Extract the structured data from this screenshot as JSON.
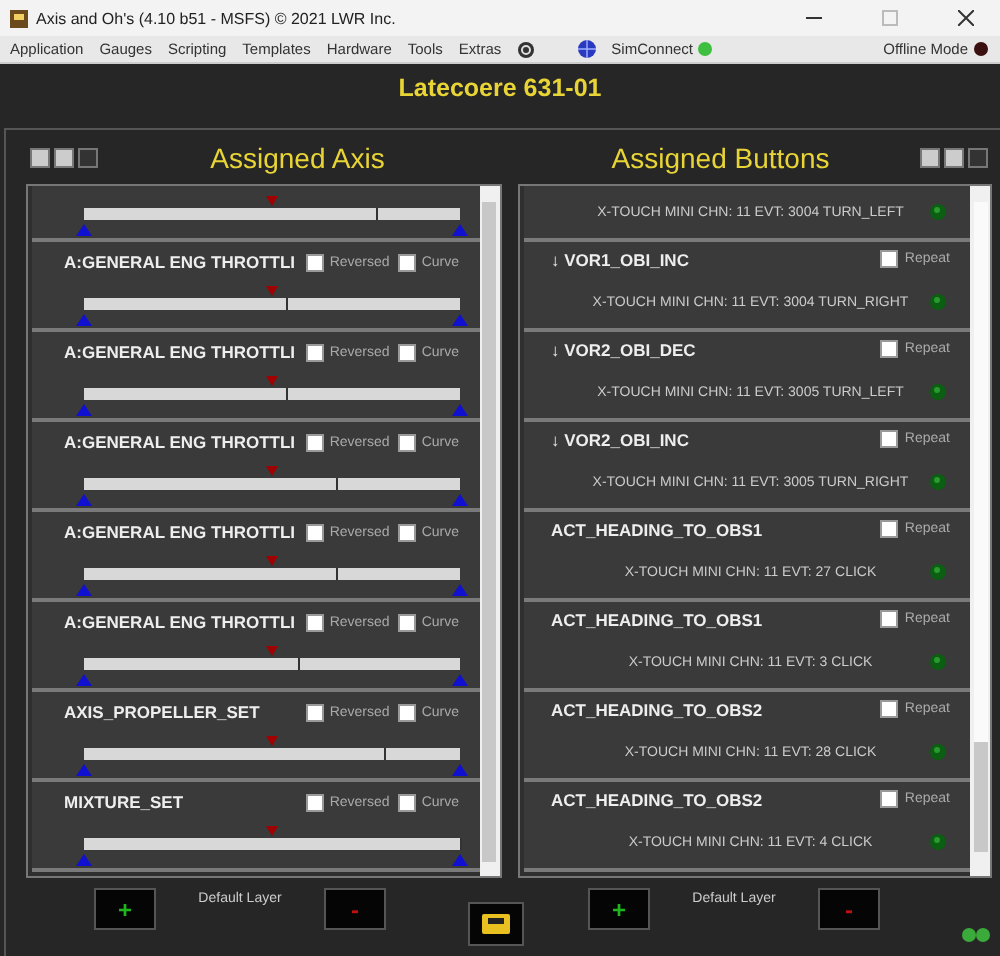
{
  "window": {
    "title": "Axis and Oh's (4.10 b51 - MSFS) © 2021 LWR Inc."
  },
  "menu": [
    "Application",
    "Gauges",
    "Scripting",
    "Templates",
    "Hardware",
    "Tools",
    "Extras"
  ],
  "simconnect": {
    "label": "SimConnect",
    "connected": true
  },
  "offline_mode": {
    "label": "Offline Mode",
    "on": false
  },
  "profile_title": "Latecoere 631-01",
  "axis_panel": {
    "heading": "Assigned Axis",
    "rows": [
      {
        "kind": "partial",
        "level": 0.78
      },
      {
        "kind": "axis",
        "name": "A:GENERAL ENG THROTTLI",
        "reversed": false,
        "reversed_label": "Reversed",
        "curve": false,
        "curve_label": "Curve",
        "level": 0.54
      },
      {
        "kind": "axis",
        "name": "A:GENERAL ENG THROTTLI",
        "reversed": false,
        "reversed_label": "Reversed",
        "curve": false,
        "curve_label": "Curve",
        "level": 0.54
      },
      {
        "kind": "axis",
        "name": "A:GENERAL ENG THROTTLI",
        "reversed": false,
        "reversed_label": "Reversed",
        "curve": false,
        "curve_label": "Curve",
        "level": 0.67
      },
      {
        "kind": "axis",
        "name": "A:GENERAL ENG THROTTLI",
        "reversed": false,
        "reversed_label": "Reversed",
        "curve": false,
        "curve_label": "Curve",
        "level": 0.67
      },
      {
        "kind": "axis",
        "name": "A:GENERAL ENG THROTTLI",
        "reversed": false,
        "reversed_label": "Reversed",
        "curve": false,
        "curve_label": "Curve",
        "level": 0.57
      },
      {
        "kind": "axis",
        "name": "AXIS_PROPELLER_SET",
        "reversed": false,
        "reversed_label": "Reversed",
        "curve": false,
        "curve_label": "Curve",
        "level": 0.8
      },
      {
        "kind": "axis",
        "name": "MIXTURE_SET",
        "reversed": false,
        "reversed_label": "Reversed",
        "curve": false,
        "curve_label": "Curve",
        "level": 1
      }
    ]
  },
  "buttons_panel": {
    "heading": "Assigned Buttons",
    "rows": [
      {
        "kind": "partial",
        "event": "X-TOUCH MINI CHN: 11 EVT: 3004 TURN_LEFT"
      },
      {
        "kind": "button",
        "name": "↓ VOR1_OBI_INC",
        "repeat": false,
        "repeat_label": "Repeat",
        "event": "X-TOUCH MINI CHN: 11 EVT: 3004 TURN_RIGHT"
      },
      {
        "kind": "button",
        "name": "↓ VOR2_OBI_DEC",
        "repeat": false,
        "repeat_label": "Repeat",
        "event": "X-TOUCH MINI CHN: 11 EVT: 3005 TURN_LEFT"
      },
      {
        "kind": "button",
        "name": "↓ VOR2_OBI_INC",
        "repeat": false,
        "repeat_label": "Repeat",
        "event": "X-TOUCH MINI CHN: 11 EVT: 3005 TURN_RIGHT"
      },
      {
        "kind": "button",
        "name": "ACT_HEADING_TO_OBS1",
        "repeat": false,
        "repeat_label": "Repeat",
        "event": "X-TOUCH MINI CHN: 11 EVT: 27 CLICK"
      },
      {
        "kind": "button",
        "name": "ACT_HEADING_TO_OBS1",
        "repeat": false,
        "repeat_label": "Repeat",
        "event": "X-TOUCH MINI CHN: 11 EVT: 3 CLICK"
      },
      {
        "kind": "button",
        "name": "ACT_HEADING_TO_OBS2",
        "repeat": false,
        "repeat_label": "Repeat",
        "event": "X-TOUCH MINI CHN: 11 EVT: 28 CLICK"
      },
      {
        "kind": "button",
        "name": "ACT_HEADING_TO_OBS2",
        "repeat": false,
        "repeat_label": "Repeat",
        "event": "X-TOUCH MINI CHN: 11 EVT: 4 CLICK"
      }
    ]
  },
  "layer_bars": [
    {
      "add": "+",
      "label": "Default Layer",
      "remove": "-"
    },
    {
      "add": "+",
      "label": "Default Layer",
      "remove": "-"
    }
  ]
}
